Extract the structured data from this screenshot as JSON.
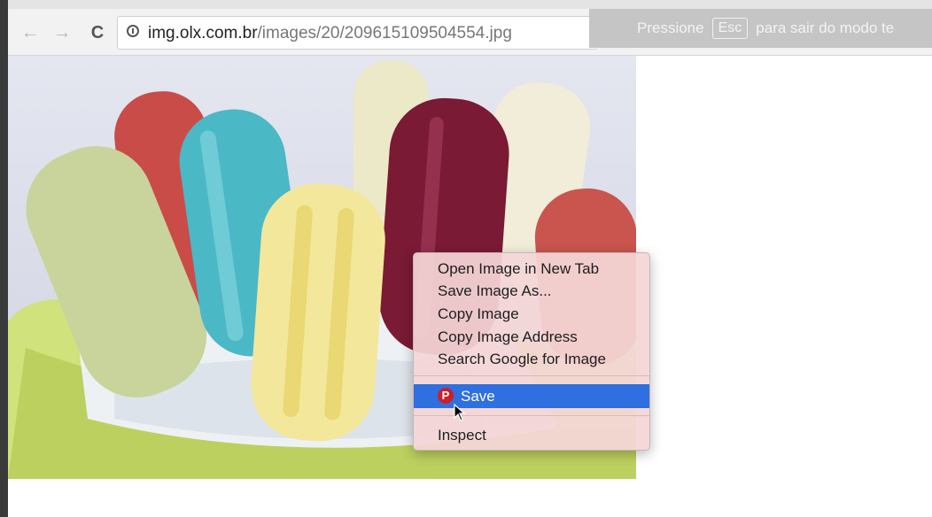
{
  "toolbar": {
    "back_icon": "arrow-left-icon",
    "forward_icon": "arrow-right-icon",
    "reload_icon": "reload-icon",
    "url_host": "img.olx.com.br",
    "url_path": "/images/20/209615109504554.jpg"
  },
  "fullscreen_banner": {
    "text_before": "Pressione",
    "key": "Esc",
    "text_after": "para sair do modo te"
  },
  "context_menu": {
    "items": [
      "Open Image in New Tab",
      "Save Image As...",
      "Copy Image",
      "Copy Image Address",
      "Search Google for Image"
    ],
    "highlighted_item": {
      "label": "Save",
      "icon": "pinterest-icon"
    },
    "last_item": "Inspect",
    "highlight_color": "#2f6fe0"
  }
}
